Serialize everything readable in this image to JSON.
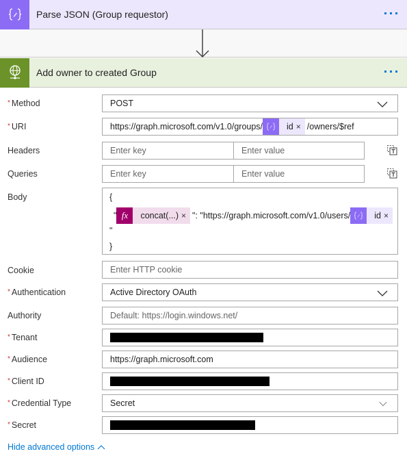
{
  "steps": [
    {
      "title": "Parse JSON (Group requestor)",
      "icon": "braces-edit-icon",
      "color": "#8c6cf5"
    },
    {
      "title": "Add owner to created Group",
      "icon": "globe-icon",
      "color": "#6b932a"
    }
  ],
  "connector": {
    "icon": "arrow-down-icon"
  },
  "form": {
    "method": {
      "label": "Method",
      "required": true,
      "value": "POST"
    },
    "uri": {
      "label": "URI",
      "required": true,
      "prefix": "https://graph.microsoft.com/v1.0/groups/",
      "token": {
        "label": "id",
        "type": "variable"
      },
      "suffix": "/owners/$ref"
    },
    "headers": {
      "label": "Headers",
      "key_placeholder": "Enter key",
      "value_placeholder": "Enter value"
    },
    "queries": {
      "label": "Queries",
      "key_placeholder": "Enter key",
      "value_placeholder": "Enter value"
    },
    "body": {
      "label": "Body",
      "line1": "{",
      "line2_quote": "\"",
      "fx_token": {
        "label": "concat(...)",
        "type": "expression",
        "icon_text": "fx"
      },
      "line2_text": "\": \"https://graph.microsoft.com/v1.0/users/",
      "var_token": {
        "label": "id",
        "type": "variable"
      },
      "line3": "\"",
      "line4": "}"
    },
    "cookie": {
      "label": "Cookie",
      "placeholder": "Enter HTTP cookie"
    },
    "authentication": {
      "label": "Authentication",
      "required": true,
      "value": "Active Directory OAuth"
    },
    "authority": {
      "label": "Authority",
      "placeholder": "Default: https://login.windows.net/"
    },
    "tenant": {
      "label": "Tenant",
      "required": true,
      "value": "[redacted]"
    },
    "audience": {
      "label": "Audience",
      "required": true,
      "value": "https://graph.microsoft.com"
    },
    "client_id": {
      "label": "Client ID",
      "required": true,
      "value": "[redacted]"
    },
    "credential_type": {
      "label": "Credential Type",
      "required": true,
      "value": "Secret"
    },
    "secret": {
      "label": "Secret",
      "required": true,
      "value": "[redacted]"
    }
  },
  "required_marker": "*",
  "token_remove": "×",
  "hide_advanced": "Hide advanced options",
  "colors": {
    "accent": "#0078d4",
    "required": "#d13438",
    "variable": "#8c6cf5",
    "expression": "#a1006b"
  }
}
